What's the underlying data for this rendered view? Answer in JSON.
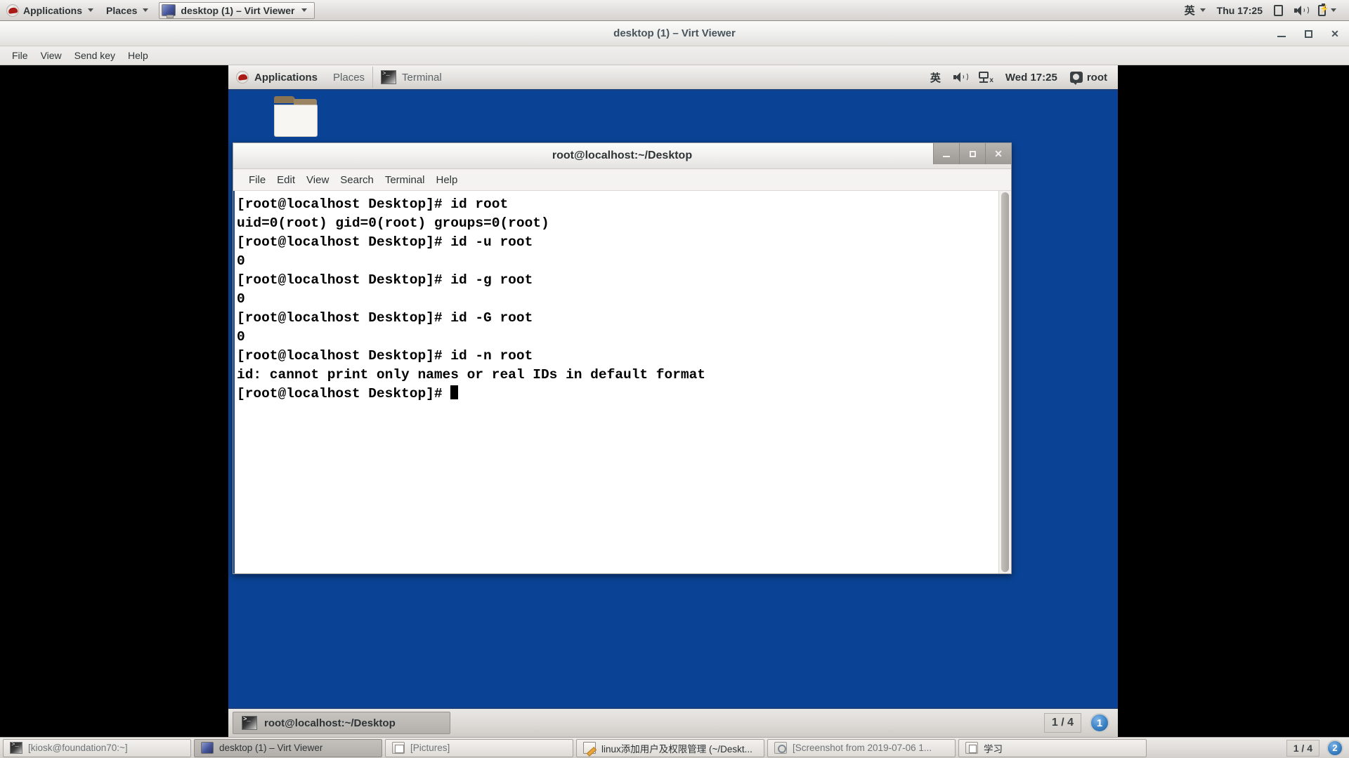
{
  "host_panel": {
    "applications_label": "Applications",
    "places_label": "Places",
    "window_button_label": "desktop (1) – Virt Viewer",
    "tray": {
      "ime_label": "英",
      "clock": "Thu 17:25",
      "screen_icon": "screen-icon",
      "volume_icon": "volume-icon",
      "battery_icon": "battery-icon"
    }
  },
  "virt_viewer": {
    "title": "desktop (1) – Virt Viewer",
    "menu": [
      "File",
      "View",
      "Send key",
      "Help"
    ],
    "controls": {
      "minimize": "minimize-button",
      "maximize": "maximize-button",
      "close": "✕"
    }
  },
  "guest_panel": {
    "applications_label": "Applications",
    "places_label": "Places",
    "window_label": "Terminal",
    "tray": {
      "ime_label": "英",
      "clock": "Wed 17:25",
      "user_label": "root"
    }
  },
  "terminal": {
    "title": "root@localhost:~/Desktop",
    "menu": [
      "File",
      "Edit",
      "View",
      "Search",
      "Terminal",
      "Help"
    ],
    "buttons": {
      "minimize": "_",
      "maximize": "□",
      "close": "✕"
    },
    "content": "[root@localhost Desktop]# id root\nuid=0(root) gid=0(root) groups=0(root)\n[root@localhost Desktop]# id -u root\n0\n[root@localhost Desktop]# id -g root\n0\n[root@localhost Desktop]# id -G root\n0\n[root@localhost Desktop]# id -n root\nid: cannot print only names or real IDs in default format\n[root@localhost Desktop]# "
  },
  "guest_taskbar": {
    "window_button": "root@localhost:~/Desktop",
    "workspace_count": "1 / 4",
    "workspace_badge": "1"
  },
  "host_taskbar": {
    "items": [
      {
        "label": "[kiosk@foundation70:~]",
        "icon": "terminal-icon",
        "state": "dim"
      },
      {
        "label": "desktop (1) – Virt Viewer",
        "icon": "monitor-icon",
        "state": "active"
      },
      {
        "label": "[Pictures]",
        "icon": "pictures-icon",
        "state": "dim"
      },
      {
        "label": "linux添加用户及权限管理 (~/Deskt...",
        "icon": "gedit-icon",
        "state": "normal"
      },
      {
        "label": "[Screenshot from 2019-07-06 1...",
        "icon": "screenshot-icon",
        "state": "dim"
      },
      {
        "label": "学习",
        "icon": "folder-study-icon",
        "state": "normal"
      }
    ],
    "workspace_count": "1 / 4",
    "workspace_badge": "2"
  },
  "colors": {
    "desktop_blue": "#0a4395",
    "panel_grey": "#e2e0de",
    "accent_blue": "#3b82c4"
  }
}
